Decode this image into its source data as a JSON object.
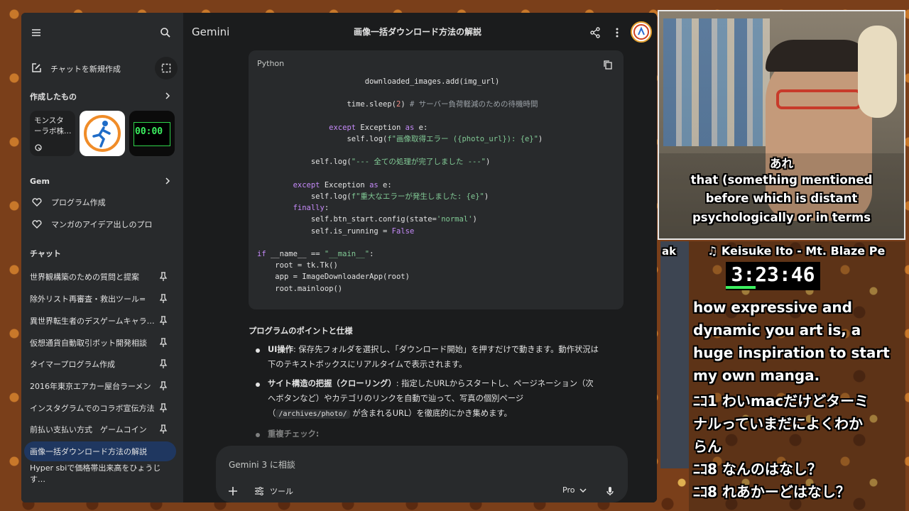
{
  "sidebar": {
    "new_chat": "チャットを新規作成",
    "created_heading": "作成したもの",
    "cards": [
      {
        "label_line1": "モンスタ",
        "label_line2": "ーラボ株…"
      },
      {
        "label": ""
      },
      {
        "label": "00:00"
      }
    ],
    "gem_heading": "Gem",
    "gems": [
      "プログラム作成",
      "マンガのアイデア出しのプロ"
    ],
    "chats_heading": "チャット",
    "chats": [
      "世界観構築のための質問と提案",
      "除外リスト再審査・救出ツール=",
      "異世界転生者のデスゲームキャラ…",
      "仮想通貨自動取引ボット開発相談",
      "タイマープログラム作成",
      "2016年東京エアカー屋台ラーメン",
      "インスタグラムでのコラボ宣伝方法",
      "前払い支払い方式　ゲームコイン",
      "画像一括ダウンロード方法の解説",
      "Hyper sbiで価格帯出来高をひょうじす…"
    ]
  },
  "topbar": {
    "brand": "Gemini",
    "title": "画像一括ダウンロード方法の解説"
  },
  "code": {
    "language": "Python",
    "lines": [
      {
        "indent": "                        ",
        "parts": [
          {
            "t": "downloaded_images.add(img_url)",
            "c": ""
          }
        ]
      },
      {
        "indent": "",
        "parts": [
          {
            "t": "",
            "c": ""
          }
        ]
      },
      {
        "indent": "                    ",
        "parts": [
          {
            "t": "time.sleep(",
            "c": ""
          },
          {
            "t": "2",
            "c": "num"
          },
          {
            "t": ") ",
            "c": ""
          },
          {
            "t": "# サーバー負荷軽減のための待機時間",
            "c": "cm"
          }
        ]
      },
      {
        "indent": "",
        "parts": [
          {
            "t": "",
            "c": ""
          }
        ]
      },
      {
        "indent": "                ",
        "parts": [
          {
            "t": "except",
            "c": "kw"
          },
          {
            "t": " Exception ",
            "c": ""
          },
          {
            "t": "as",
            "c": "kw"
          },
          {
            "t": " e:",
            "c": ""
          }
        ]
      },
      {
        "indent": "                    ",
        "parts": [
          {
            "t": "self.log(",
            "c": ""
          },
          {
            "t": "f\"画像取得エラー ({photo_url}): {e}\"",
            "c": "str"
          },
          {
            "t": ")",
            "c": ""
          }
        ]
      },
      {
        "indent": "",
        "parts": [
          {
            "t": "",
            "c": ""
          }
        ]
      },
      {
        "indent": "            ",
        "parts": [
          {
            "t": "self.log(",
            "c": ""
          },
          {
            "t": "\"--- 全ての処理が完了しました ---\"",
            "c": "str"
          },
          {
            "t": ")",
            "c": ""
          }
        ]
      },
      {
        "indent": "",
        "parts": [
          {
            "t": "",
            "c": ""
          }
        ]
      },
      {
        "indent": "        ",
        "parts": [
          {
            "t": "except",
            "c": "kw"
          },
          {
            "t": " Exception ",
            "c": ""
          },
          {
            "t": "as",
            "c": "kw"
          },
          {
            "t": " e:",
            "c": ""
          }
        ]
      },
      {
        "indent": "            ",
        "parts": [
          {
            "t": "self.log(",
            "c": ""
          },
          {
            "t": "f\"重大なエラーが発生しました: {e}\"",
            "c": "str"
          },
          {
            "t": ")",
            "c": ""
          }
        ]
      },
      {
        "indent": "        ",
        "parts": [
          {
            "t": "finally",
            "c": "kw"
          },
          {
            "t": ":",
            "c": ""
          }
        ]
      },
      {
        "indent": "            ",
        "parts": [
          {
            "t": "self.btn_start.config(state=",
            "c": ""
          },
          {
            "t": "'normal'",
            "c": "str"
          },
          {
            "t": ")",
            "c": ""
          }
        ]
      },
      {
        "indent": "            ",
        "parts": [
          {
            "t": "self.is_running = ",
            "c": ""
          },
          {
            "t": "False",
            "c": "kw"
          }
        ]
      },
      {
        "indent": "",
        "parts": [
          {
            "t": "",
            "c": ""
          }
        ]
      },
      {
        "indent": "",
        "parts": [
          {
            "t": "if",
            "c": "kw"
          },
          {
            "t": " __name__ == ",
            "c": ""
          },
          {
            "t": "\"__main__\"",
            "c": "str"
          },
          {
            "t": ":",
            "c": ""
          }
        ]
      },
      {
        "indent": "    ",
        "parts": [
          {
            "t": "root = tk.Tk()",
            "c": ""
          }
        ]
      },
      {
        "indent": "    ",
        "parts": [
          {
            "t": "app = ImageDownloaderApp(root)",
            "c": ""
          }
        ]
      },
      {
        "indent": "    ",
        "parts": [
          {
            "t": "root.mainloop()",
            "c": ""
          }
        ]
      }
    ]
  },
  "content": {
    "heading": "プログラムのポイントと仕様",
    "b1_bold": "UI操作",
    "b1_text": ": 保存先フォルダを選択し、「ダウンロード開始」を押すだけで動きます。動作状況は",
    "b1_text2": "下のテキストボックスにリアルタイムで表示されます。",
    "b2_bold": "サイト構造の把握（クローリング）",
    "b2_text": ": 指定したURLからスタートし、ページネーション（次",
    "b2_text2": "へボタンなど）やカテゴリのリンクを自動で辿って、写真の個別ページ",
    "b2_text3a": "（",
    "b2_code": "/archives/photo/",
    "b2_text3b": " が含まれるURL）を徹底的にかき集めます。",
    "b3_bold": "重複チェック:"
  },
  "input": {
    "placeholder": "Gemini 3 に相談",
    "tools": "ツール",
    "model": "Pro"
  },
  "stream": {
    "cam_caption": [
      "あれ",
      "that (something mentioned",
      "before which is distant",
      "psychologically or in terms"
    ],
    "music": "♫ Keisuke Ito - Mt. Blaze Pe",
    "timer": "3:23:46",
    "left_fragment": "ak",
    "chat_lines": [
      "how expressive and",
      "dynamic you art is, a",
      "huge inspiration to start",
      "my own manga.",
      "ﾆｺ1 わいmacだけどターミ",
      "ナルっていまだによくわか",
      "らん",
      "ﾆｺ8 なんのはなし？",
      "ﾆｺ8 れあかーどはなし？"
    ]
  }
}
